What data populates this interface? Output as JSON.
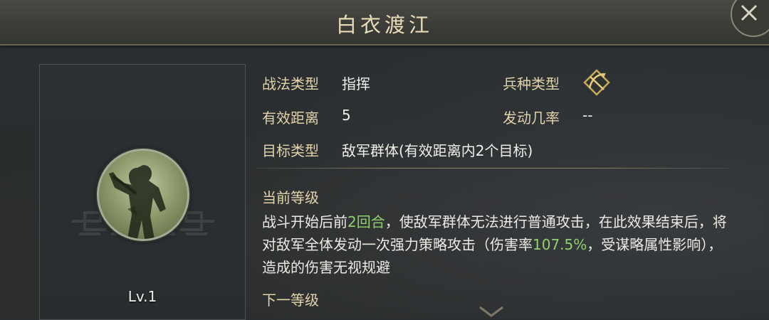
{
  "window": {
    "title": "白衣渡江"
  },
  "portrait": {
    "level": "Lv.1"
  },
  "info": {
    "tactic_type_label": "战法类型",
    "tactic_type_value": "指挥",
    "troop_type_label": "兵种类型",
    "troop_type_icon": "bow-crossed-icon",
    "range_label": "有效距离",
    "range_value": "5",
    "trigger_rate_label": "发动几率",
    "trigger_rate_value": "--",
    "target_label": "目标类型",
    "target_value": "敌军群体(有效距离内2个目标)"
  },
  "current_level": {
    "title": "当前等级",
    "desc_part1": "战斗开始后前",
    "desc_rounds": "2回合",
    "desc_part2": "，使敌军群体无法进行普通攻击，在此效果结束后，将对敌军全体发动一次强力策略攻击（伤害率",
    "desc_rate": "107.5%",
    "desc_part3": "，受谋略属性影响），造成的伤害无视规避"
  },
  "next_level": {
    "title": "下一等级"
  },
  "colors": {
    "label": "#e2d3a8",
    "value": "#f0f0ea",
    "highlight": "#8fd16c",
    "title": "#e8dcb6"
  }
}
